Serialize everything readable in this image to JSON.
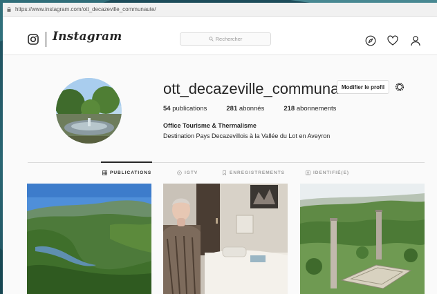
{
  "browser": {
    "url": "https://www.instagram.com/ott_decazeville_communaute/"
  },
  "header": {
    "logo_text": "Instagram",
    "search_placeholder": "Rechercher",
    "icons": [
      "explore-compass-icon",
      "activity-heart-icon",
      "profile-person-icon"
    ]
  },
  "profile": {
    "username": "ott_decazeville_communaute",
    "edit_button": "Modifier le profil",
    "stats": [
      {
        "count": "54",
        "label": "publications"
      },
      {
        "count": "281",
        "label": "abonnés"
      },
      {
        "count": "218",
        "label": "abonnements"
      }
    ],
    "full_name": "Office Tourisme & Thermalisme",
    "bio": "Destination Pays Decazevillois à la Vallée du Lot en Aveyron"
  },
  "tabs": [
    {
      "label": "PUBLICATIONS",
      "active": true
    },
    {
      "label": "IGTV",
      "active": false
    },
    {
      "label": "ENREGISTREMENTS",
      "active": false
    },
    {
      "label": "IDENTIFIÉ(E)",
      "active": false
    }
  ],
  "posts": [
    {
      "subject": "valley-landscape-photo"
    },
    {
      "subject": "spa-treatment-room-photo"
    },
    {
      "subject": "chimney-industrial-site-photo"
    }
  ],
  "colors": {
    "background": "#fafafa",
    "text": "#262626",
    "muted": "#999999",
    "border": "#dbdbdb",
    "desktop_teal": "#2a6673"
  }
}
